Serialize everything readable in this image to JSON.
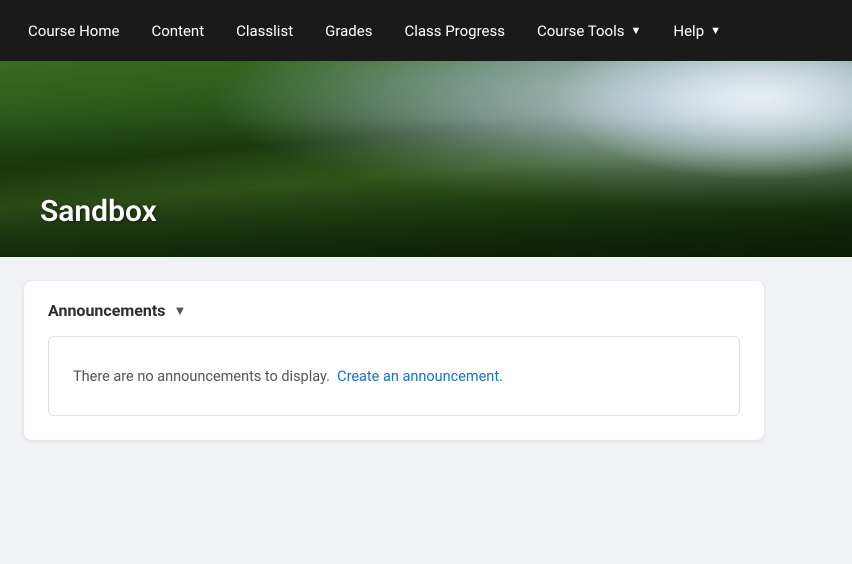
{
  "nav": {
    "items": [
      {
        "label": "Course Home",
        "hasDropdown": false,
        "id": "course-home"
      },
      {
        "label": "Content",
        "hasDropdown": false,
        "id": "content"
      },
      {
        "label": "Classlist",
        "hasDropdown": false,
        "id": "classlist"
      },
      {
        "label": "Grades",
        "hasDropdown": false,
        "id": "grades"
      },
      {
        "label": "Class Progress",
        "hasDropdown": false,
        "id": "class-progress"
      },
      {
        "label": "Course Tools",
        "hasDropdown": true,
        "id": "course-tools"
      },
      {
        "label": "Help",
        "hasDropdown": true,
        "id": "help"
      }
    ]
  },
  "hero": {
    "title": "Sandbox"
  },
  "announcements": {
    "section_title": "Announcements",
    "empty_message": "There are no announcements to display.",
    "create_link_text": "Create an announcement."
  }
}
